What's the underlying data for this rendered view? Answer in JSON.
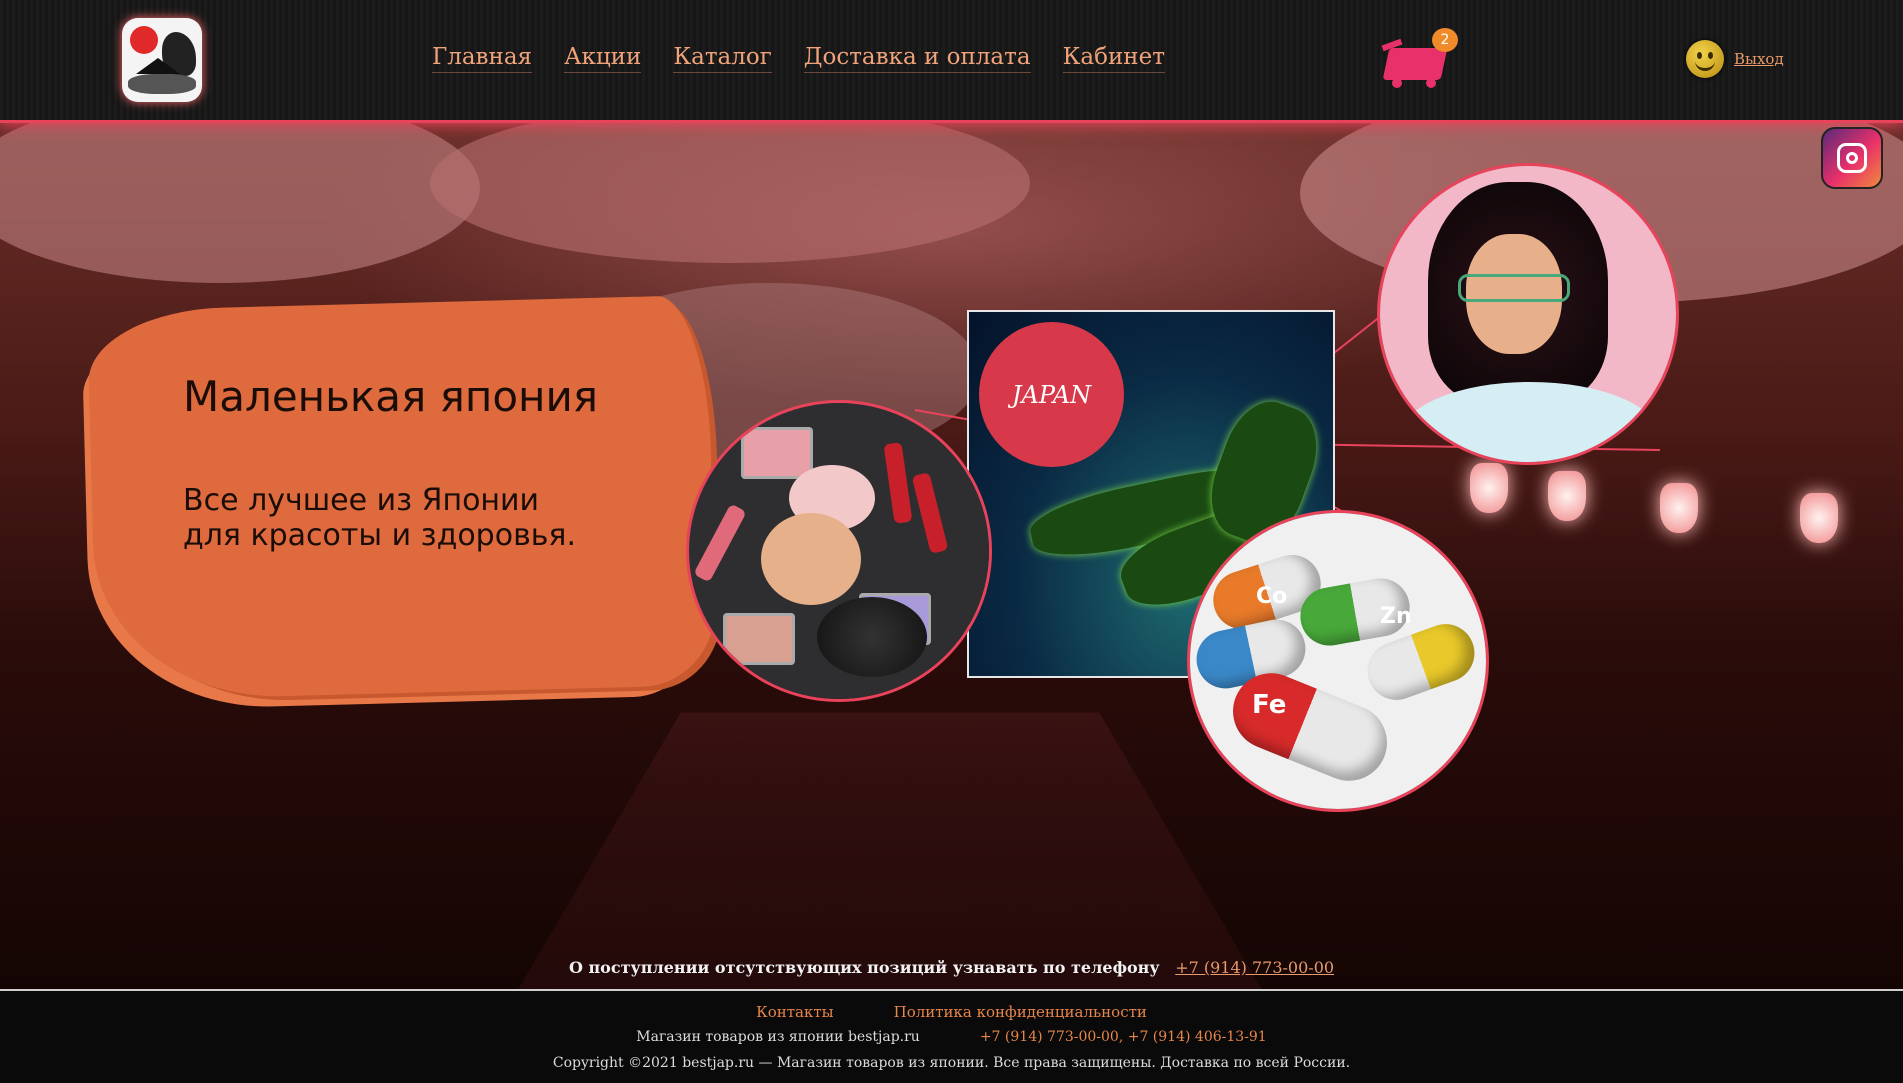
{
  "header": {
    "nav": [
      "Главная",
      "Акции",
      "Каталог",
      "Доставка и оплата",
      "Кабинет"
    ],
    "cart_count": "2",
    "logout_label": "Выход"
  },
  "hero": {
    "title": "Маленькая япония",
    "subtitle_line1": "Все лучшее из Японии",
    "subtitle_line2": "для красоты и здоровья.",
    "map_badge": "JAPAN",
    "vitamins": [
      "Co",
      "Zn",
      "Fe"
    ]
  },
  "notice": {
    "text": "О поступлении отсутствующих позиций узнавать по телефону",
    "phone": "+7 (914) 773-00-00"
  },
  "footer": {
    "links": [
      "Контакты",
      "Политика конфиденциальности"
    ],
    "shop_name": "Магазин товаров из японии bestjap.ru",
    "phones": "+7 (914) 773-00-00, +7 (914) 406-13-91",
    "copyright": "Copyright ©2021 bestjap.ru — Магазин товаров из японии. Все права защищены. Доставка по всей России."
  },
  "colors": {
    "accent": "#e8435a",
    "nav_text": "#f0a37a",
    "brush": "#de6a3e",
    "footer_link": "#e8854a"
  },
  "icons": [
    "logo-icon",
    "cart-icon",
    "smiley-avatar-icon",
    "instagram-icon"
  ]
}
